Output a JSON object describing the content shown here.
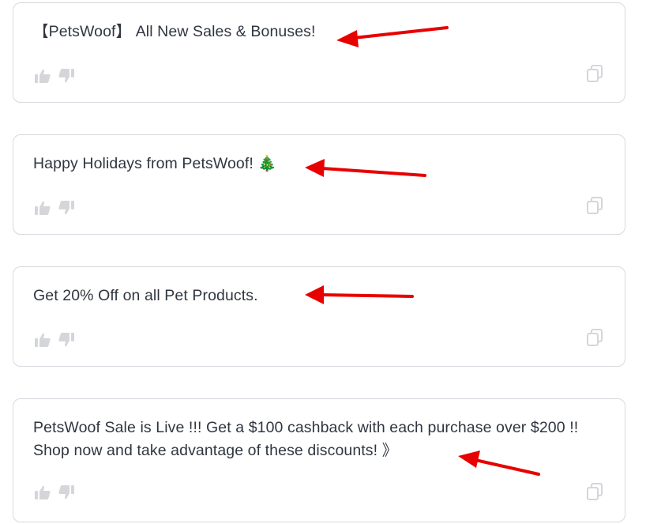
{
  "messages": [
    {
      "text": "【PetsWoof】 All New Sales & Bonuses!"
    },
    {
      "text": "Happy Holidays from PetsWoof! 🎄"
    },
    {
      "text": "Get 20% Off on all Pet Products."
    },
    {
      "text": "PetsWoof Sale is Live !!! Get a $100 cashback with each purchase over $200 !! Shop now and take advantage of these discounts! 》"
    }
  ],
  "icons": {
    "like": "thumbs-up-icon",
    "dislike": "thumbs-down-icon",
    "copy": "copy-icon",
    "annotation": "red-arrow"
  },
  "colors": {
    "text": "#2f3640",
    "icon": "#d4d6da",
    "border": "#d6d9de",
    "arrow": "#e80000"
  }
}
